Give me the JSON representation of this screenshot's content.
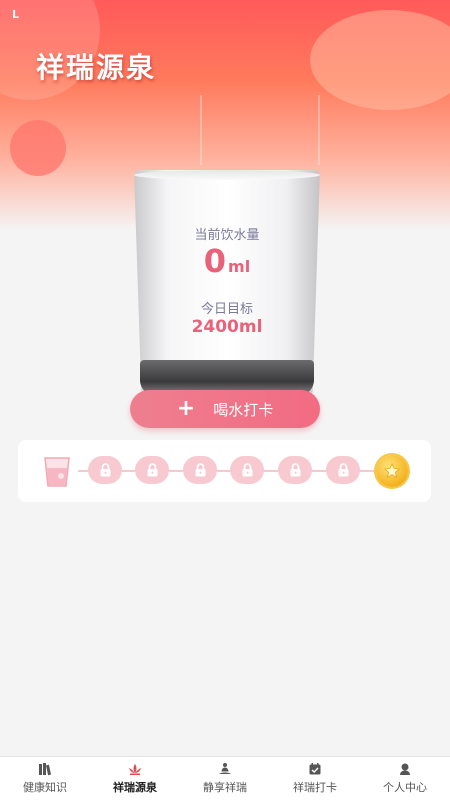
{
  "status_bar": {
    "carrier": "L"
  },
  "header": {
    "title": "祥瑞源泉"
  },
  "glass": {
    "current_label": "当前饮水量",
    "current_value": "0",
    "current_unit": "ml",
    "target_label": "今日目标",
    "target_value": "2400ml"
  },
  "checkin_button": {
    "icon": "plus-icon",
    "label": "喝水打卡"
  },
  "progress": {
    "nodes": [
      "cup-icon",
      "lock-icon",
      "lock-icon",
      "lock-icon",
      "lock-icon",
      "lock-icon",
      "lock-icon",
      "coin-star-icon"
    ],
    "lock_color": "#f8c9d1",
    "coin_color": "#f4b21f"
  },
  "tabs": [
    {
      "label": "健康知识",
      "icon": "books-icon",
      "active": false
    },
    {
      "label": "祥瑞源泉",
      "icon": "lotus-icon",
      "active": true
    },
    {
      "label": "静享祥瑞",
      "icon": "meditation-icon",
      "active": false
    },
    {
      "label": "祥瑞打卡",
      "icon": "calendar-check-icon",
      "active": false
    },
    {
      "label": "个人中心",
      "icon": "person-icon",
      "active": false
    }
  ],
  "colors": {
    "accent": "#e8627a",
    "header_red": "#ff5a5a",
    "button": "#f26b82"
  }
}
